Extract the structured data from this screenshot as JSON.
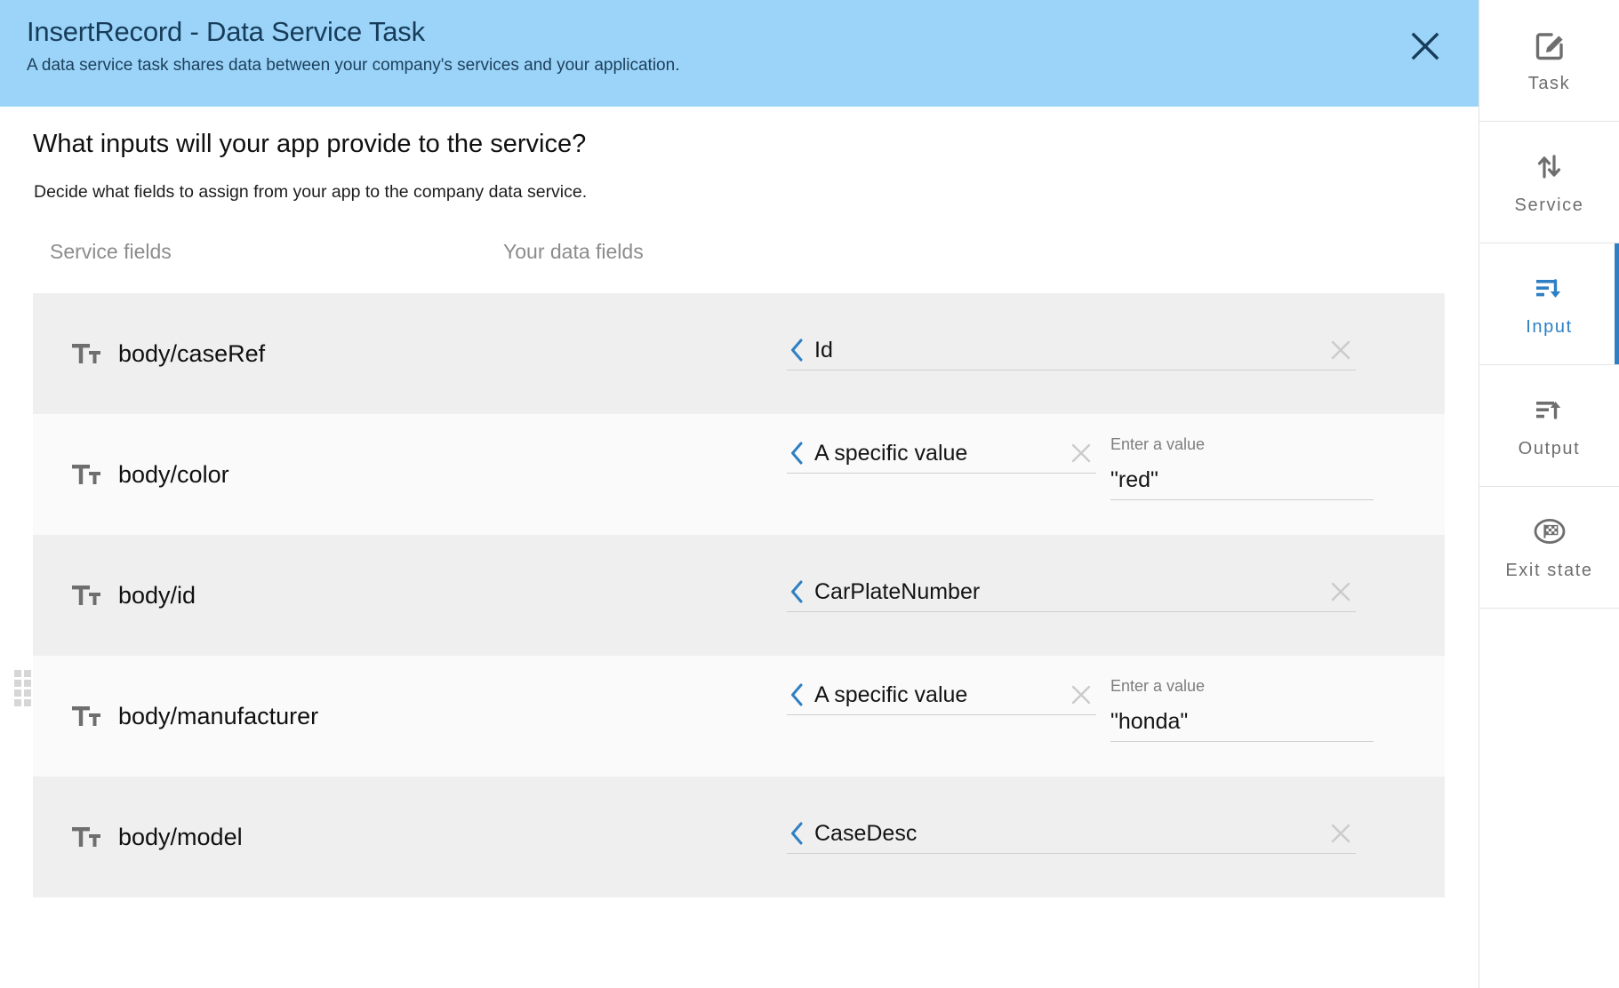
{
  "header": {
    "title": "InsertRecord - Data Service Task",
    "subtitle": "A data service task shares data between your company's services and your application.",
    "close_label": "close-icon",
    "background_color": "#9bd4f8",
    "text_color": "#173c5a"
  },
  "main": {
    "question": "What inputs will your app provide to the service?",
    "instruction": "Decide what fields to assign from your app to the company data service.",
    "columns": {
      "service_fields": "Service fields",
      "your_data_fields": "Your data fields"
    },
    "rows": [
      {
        "type_icon": "text-type-icon",
        "service_field": "body/caseRef",
        "mapping_kind": "field",
        "mapping_value": "Id",
        "value_label": "",
        "value_text": "",
        "has_clear": true
      },
      {
        "type_icon": "text-type-icon",
        "service_field": "body/color",
        "mapping_kind": "specific-value",
        "mapping_value": "A specific value",
        "value_label": "Enter a value",
        "value_text": "\"red\"",
        "has_clear": true
      },
      {
        "type_icon": "text-type-icon",
        "service_field": "body/id",
        "mapping_kind": "field",
        "mapping_value": "CarPlateNumber",
        "value_label": "",
        "value_text": "",
        "has_clear": true
      },
      {
        "type_icon": "text-type-icon",
        "service_field": "body/manufacturer",
        "mapping_kind": "specific-value",
        "mapping_value": "A specific value",
        "value_label": "Enter a value",
        "value_text": "\"honda\"",
        "has_clear": true
      },
      {
        "type_icon": "text-type-icon",
        "service_field": "body/model",
        "mapping_kind": "field",
        "mapping_value": "CaseDesc",
        "value_label": "",
        "value_text": "",
        "has_clear": true
      }
    ]
  },
  "sidebar": {
    "accent_color": "#2e7fc4",
    "items": [
      {
        "label": "Task",
        "icon": "edit-square-icon",
        "active": false
      },
      {
        "label": "Service",
        "icon": "up-down-arrows-icon",
        "active": false
      },
      {
        "label": "Input",
        "icon": "lines-down-arrow-icon",
        "active": true
      },
      {
        "label": "Output",
        "icon": "lines-up-arrow-icon",
        "active": false
      },
      {
        "label": "Exit state",
        "icon": "checkered-flag-circle-icon",
        "active": false
      }
    ]
  }
}
